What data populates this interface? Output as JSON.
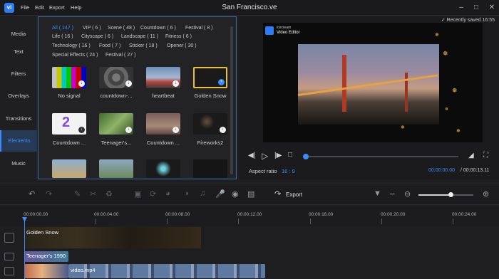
{
  "titlebar": {
    "logo_text": "vi",
    "menus": [
      "File",
      "Edit",
      "Export",
      "Help"
    ],
    "title": "San Francisco.ve"
  },
  "sidebar": {
    "items": [
      "Media",
      "Text",
      "Filters",
      "Overlays",
      "Transitions",
      "Elements",
      "Music"
    ],
    "active": "Elements"
  },
  "categories": {
    "row1": [
      "All ( 147 )",
      "VIP ( 6 )",
      "Scene ( 48 )",
      "Countdown ( 6 )",
      "Festival ( 8 )"
    ],
    "row2": [
      "Life ( 16 )",
      "Cityscape ( 6 )",
      "Landscape ( 11 )",
      "Fitness ( 6 )"
    ],
    "row3": [
      "Technology ( 16 )",
      "Food ( 7 )",
      "Sticker ( 18 )",
      "Opener ( 30 )"
    ],
    "row4": [
      "Special Effects ( 24 )",
      "Festival ( 27 )"
    ]
  },
  "elements": {
    "items": [
      "No signal",
      "countdown-...",
      "heartbeat",
      "Golden Snow",
      "Countdown ...",
      "Teenager's...",
      "Countdown ...",
      "Fireworks2"
    ]
  },
  "preview": {
    "saved_text": "Recently saved 16:55",
    "watermark_brand": "icecream",
    "watermark_app": "Video Editor",
    "aspect_label": "Aspect ratio",
    "aspect_value": "16 : 9",
    "time_current": "00:00:00.00",
    "time_total": "/ 00:00:13.11"
  },
  "toolbar": {
    "export_label": "Export",
    "zoom_level": 0.6
  },
  "timeline": {
    "ruler": [
      "00:00:00.00",
      "00:00:04.00",
      "00:00:08.00",
      "00:00:12.00",
      "00:00:16.00",
      "00:00:20.00",
      "00:00:24.00"
    ],
    "clips": {
      "element": "Golden Snow",
      "text": "Teenager's 1990",
      "video": "video.mp4"
    }
  },
  "colors": {
    "accent": "#3b8cff",
    "panel": "#232326",
    "background": "#1e1e21"
  }
}
